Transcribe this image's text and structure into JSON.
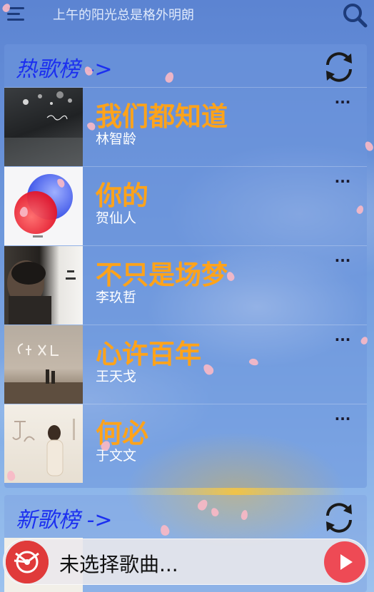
{
  "header": {
    "title": "上午的阳光总是格外明朗",
    "menu_icon": "menu-icon",
    "search_icon": "search-icon"
  },
  "hot_chart": {
    "title": "热歌榜 ->",
    "refresh_icon": "refresh-icon",
    "songs": [
      {
        "title": "我们都知道",
        "artist": "林智龄",
        "more": "···"
      },
      {
        "title": "你的",
        "artist": "贺仙人",
        "more": "···"
      },
      {
        "title": "不只是场梦",
        "artist": "李玖哲",
        "more": "···"
      },
      {
        "title": "心许百年",
        "artist": "王天戈",
        "more": "···"
      },
      {
        "title": "何必",
        "artist": "于文文",
        "more": "···"
      }
    ]
  },
  "new_chart": {
    "title": "新歌榜 ->",
    "refresh_icon": "refresh-icon"
  },
  "player": {
    "status": "未选择歌曲...",
    "disc_icon": "disc-icon",
    "play_icon": "play-icon"
  },
  "colors": {
    "section_title": "#1b2ff0",
    "song_title": "#ffa31a",
    "play_button": "#ee4a55"
  }
}
